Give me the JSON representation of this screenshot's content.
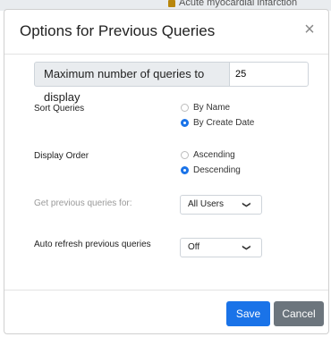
{
  "background": {
    "partial_text": "Acute myocardial infarction"
  },
  "modal": {
    "title": "Options for Previous Queries",
    "close_symbol": "×"
  },
  "max_queries": {
    "label": "Maximum number of queries to display",
    "value": "25"
  },
  "sort_queries": {
    "label": "Sort Queries",
    "options": [
      {
        "label": "By Name",
        "selected": false
      },
      {
        "label": "By Create Date",
        "selected": true
      }
    ]
  },
  "display_order": {
    "label": "Display Order",
    "options": [
      {
        "label": "Ascending",
        "selected": false
      },
      {
        "label": "Descending",
        "selected": true
      }
    ]
  },
  "get_previous_for": {
    "label": "Get previous queries for:",
    "selected": "All Users"
  },
  "auto_refresh": {
    "label": "Auto refresh previous queries",
    "selected": "Off"
  },
  "footer": {
    "save_label": "Save",
    "cancel_label": "Cancel"
  },
  "colors": {
    "primary": "#1a73e8",
    "secondary": "#6c757d",
    "label_bg": "#e9ecef"
  },
  "icons": {
    "close": "close-icon",
    "chevron": "chevron-down-icon"
  }
}
